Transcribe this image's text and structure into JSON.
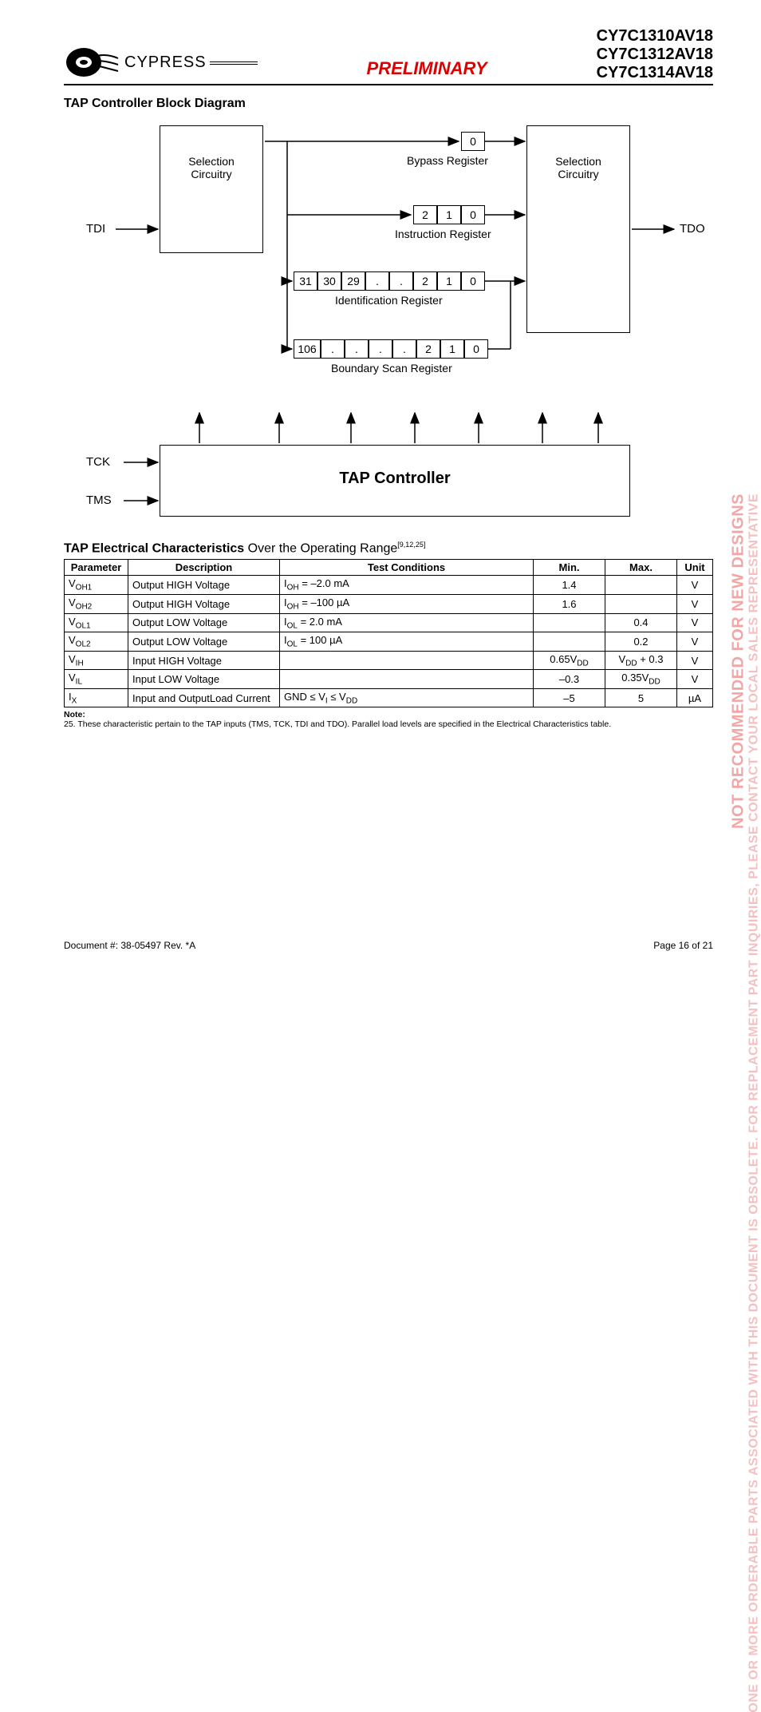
{
  "header": {
    "brand": "CYPRESS",
    "preliminary": "PRELIMINARY",
    "parts": [
      "CY7C1310AV18",
      "CY7C1312AV18",
      "CY7C1314AV18"
    ]
  },
  "diagram": {
    "title": "TAP Controller Block Diagram",
    "sel_left": "Selection\nCircuitry",
    "sel_right": "Selection\nCircuitry",
    "tap": "TAP Controller",
    "signals": {
      "tdi": "TDI",
      "tdo": "TDO",
      "tck": "TCK",
      "tms": "TMS"
    },
    "bypass": {
      "cells": [
        "0"
      ],
      "label": "Bypass Register"
    },
    "instr": {
      "cells": [
        "2",
        "1",
        "0"
      ],
      "label": "Instruction Register"
    },
    "id": {
      "cells": [
        "31",
        "30",
        "29",
        ".",
        ".",
        "2",
        "1",
        "0"
      ],
      "label": "Identification Register"
    },
    "bscan": {
      "cells": [
        "106",
        ".",
        ".",
        ".",
        ".",
        "2",
        "1",
        "0"
      ],
      "label": "Boundary Scan Register"
    }
  },
  "elec": {
    "heading_bold": "TAP Electrical Characteristics",
    "heading_rest": " Over the Operating Range",
    "heading_refs": "[9,12,25]",
    "cols": [
      "Parameter",
      "Description",
      "Test Conditions",
      "Min.",
      "Max.",
      "Unit"
    ],
    "rows": [
      {
        "p": "V<sub>OH1</sub>",
        "d": "Output HIGH Voltage",
        "t": "I<sub>OH</sub> = –2.0 mA",
        "min": "1.4",
        "max": "",
        "u": "V"
      },
      {
        "p": "V<sub>OH2</sub>",
        "d": "Output HIGH Voltage",
        "t": "I<sub>OH</sub> = –100 µA",
        "min": "1.6",
        "max": "",
        "u": "V"
      },
      {
        "p": "V<sub>OL1</sub>",
        "d": "Output LOW Voltage",
        "t": "I<sub>OL</sub> = 2.0 mA",
        "min": "",
        "max": "0.4",
        "u": "V"
      },
      {
        "p": "V<sub>OL2</sub>",
        "d": "Output LOW Voltage",
        "t": "I<sub>OL</sub> = 100 µA",
        "min": "",
        "max": "0.2",
        "u": "V"
      },
      {
        "p": "V<sub>IH</sub>",
        "d": "Input HIGH Voltage",
        "t": "",
        "min": "0.65V<sub>DD</sub>",
        "max": "V<sub>DD</sub> + 0.3",
        "u": "V"
      },
      {
        "p": "V<sub>IL</sub>",
        "d": "Input LOW Voltage",
        "t": "",
        "min": "–0.3",
        "max": "0.35V<sub>DD</sub>",
        "u": "V"
      },
      {
        "p": "I<sub>X</sub>",
        "d": "Input and OutputLoad Current",
        "t": "GND ≤ V<sub>I</sub> ≤ V<sub>DD</sub>",
        "min": "–5",
        "max": "5",
        "u": "µA"
      }
    ],
    "note_label": "Note:",
    "note_text": "25. These characteristic pertain to the TAP inputs (TMS, TCK, TDI and TDO). Parallel load levels are specified in the Electrical Characteristics table."
  },
  "footer": {
    "doc": "Document #: 38-05497 Rev. *A",
    "page": "Page 16 of 21"
  },
  "watermark": {
    "line1": "NOT RECOMMENDED FOR NEW DESIGNS",
    "line2": "ONE OR MORE ORDERABLE PARTS ASSOCIATED WITH THIS DOCUMENT IS OBSOLETE. FOR REPLACEMENT PART INQUIRIES, PLEASE CONTACT YOUR LOCAL SALES REPRESENTATIVE"
  }
}
